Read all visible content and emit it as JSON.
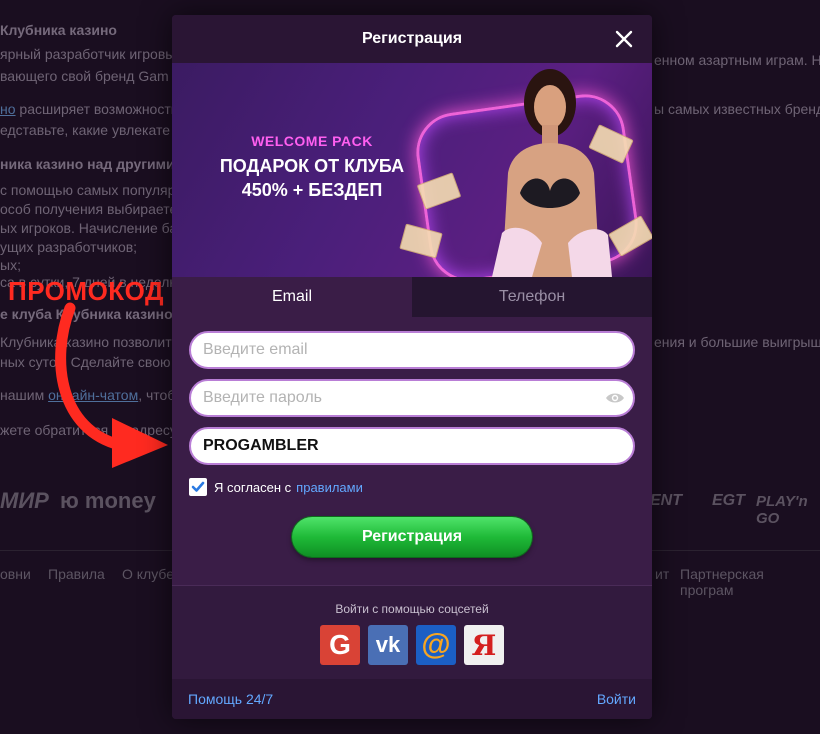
{
  "background": {
    "heading1": "Клубника казино",
    "lines": [
      "ярный разработчик игровы",
      "вающего свой бренд Gam",
      "расширяет возможности",
      "едставьте, какие увлекате"
    ],
    "link1": "но",
    "heading2": "ника казино над другими",
    "lines2": [
      "с помощью самых популяр",
      "особ получения выбираете",
      "ых игроков. Начисление ба",
      "ущих разработчиков;",
      "ых;",
      "са в сутки, 7 дней в неделю"
    ],
    "heading3": "е клуба Клубника казино",
    "lines3": [
      "Клубника казино позволит",
      "ных суток. Сделайте свою ж"
    ],
    "line_chat": "нашим",
    "chat_link": "онлайн-чатом",
    "line_chat_after": ", чтоб",
    "line_address": "жете обратиться по адресу:",
    "right_lines": [
      "енном азартным играм. Н",
      "ы самых известных бренд",
      "ения и большие выигрыш"
    ],
    "payment_logos": [
      "МИР",
      "ю money"
    ],
    "provider_logos": [
      "ENT",
      "EGT",
      "PLAY'n GO"
    ],
    "footer_items": [
      "овни",
      "Правила",
      "О клубе",
      "ит",
      "Партнерская програм"
    ]
  },
  "promo_annotation": {
    "label": "ПРОМОКОД",
    "color": "#ff2a20"
  },
  "modal": {
    "title": "Регистрация",
    "banner": {
      "tag": "WELCOME PACK",
      "line1": "ПОДАРОК ОТ КЛУБА",
      "line2": "450% + БЕЗДЕП"
    },
    "tabs": [
      {
        "label": "Email",
        "active": true
      },
      {
        "label": "Телефон",
        "active": false
      }
    ],
    "email_placeholder": "Введите email",
    "password_placeholder": "Введите пароль",
    "promo_value": "PROGAMBLER",
    "agree_checked": true,
    "agree_text": "Я согласен с",
    "agree_link": "правилами",
    "submit_label": "Регистрация",
    "social_label": "Войти с помощью соцсетей",
    "social": [
      {
        "name": "google",
        "glyph": "G"
      },
      {
        "name": "vk",
        "glyph": "vk"
      },
      {
        "name": "mailru",
        "glyph": "@"
      },
      {
        "name": "yandex",
        "glyph": "Я"
      }
    ],
    "help_link": "Помощь 24/7",
    "login_link": "Войти",
    "colors": {
      "accent_link": "#63a8ff",
      "submit_green": "#1fba38",
      "modal_bg": "#3a1d47"
    }
  }
}
